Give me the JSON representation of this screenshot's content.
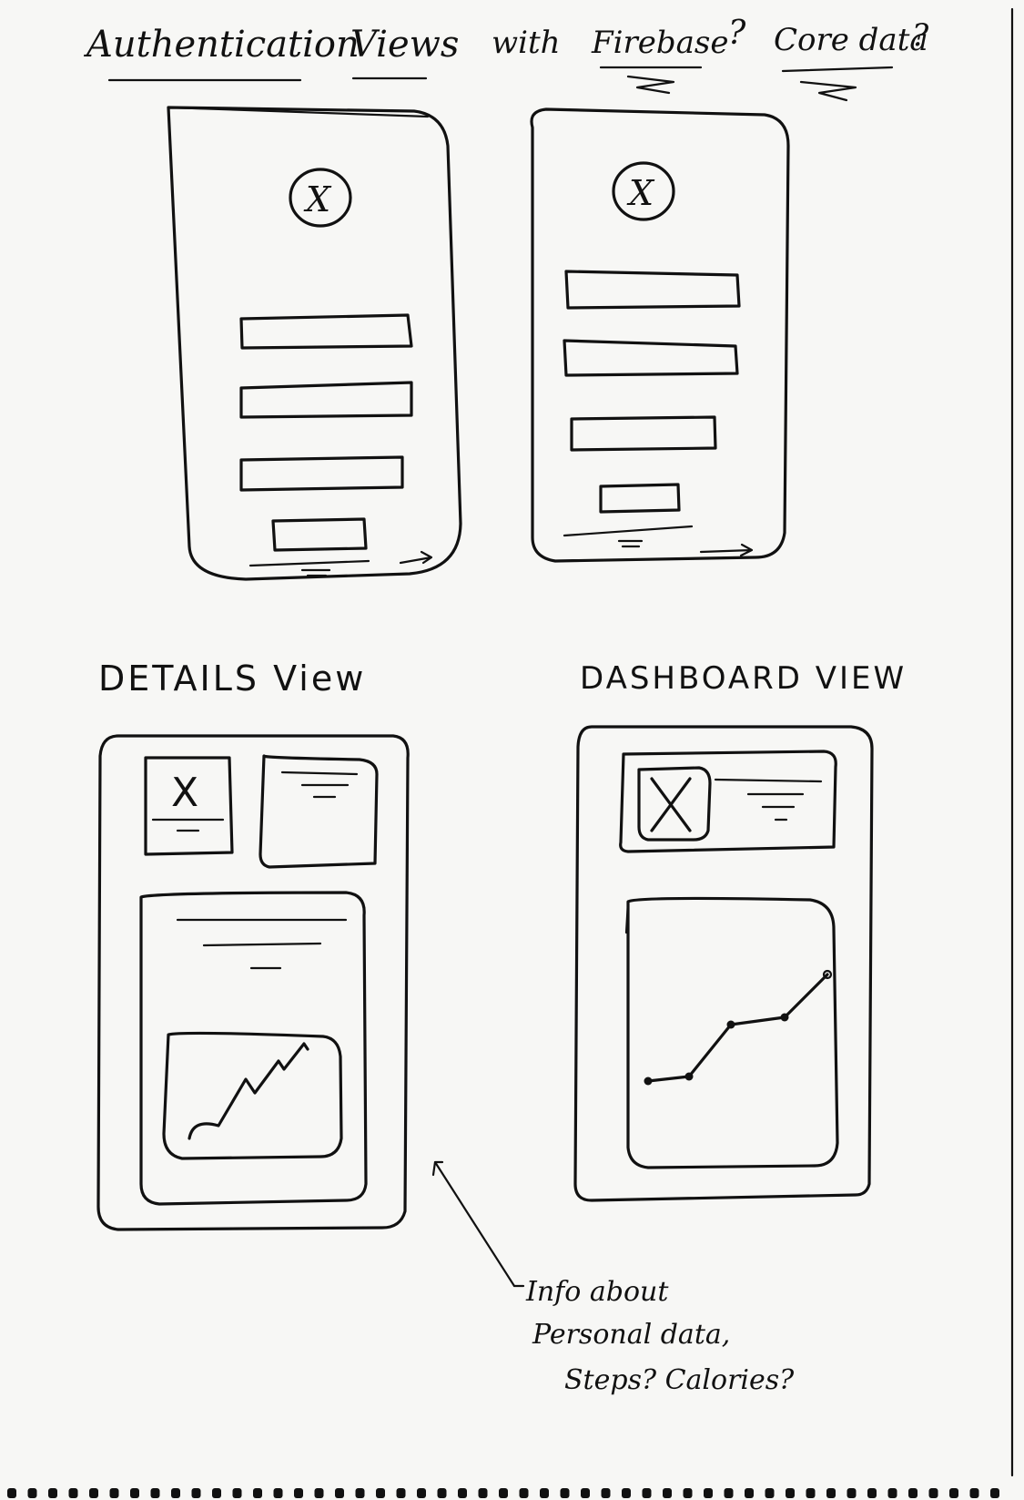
{
  "title": {
    "part1": "Authentication",
    "part2": "Views",
    "part3": "with",
    "part4": "Firebase",
    "q1": "?",
    "part5": "Core data",
    "q2": "?"
  },
  "sections": {
    "details": "DETAILS View",
    "dashboard": "DASHBOARD VIEW"
  },
  "icons": {
    "logo_mark": "X",
    "image_mark": "X"
  },
  "note": {
    "line1": "Info about",
    "line2": "Personal data,",
    "line3": "Steps? Calories?"
  },
  "ink_color": "#111111",
  "paper_color": "#f7f7f5"
}
